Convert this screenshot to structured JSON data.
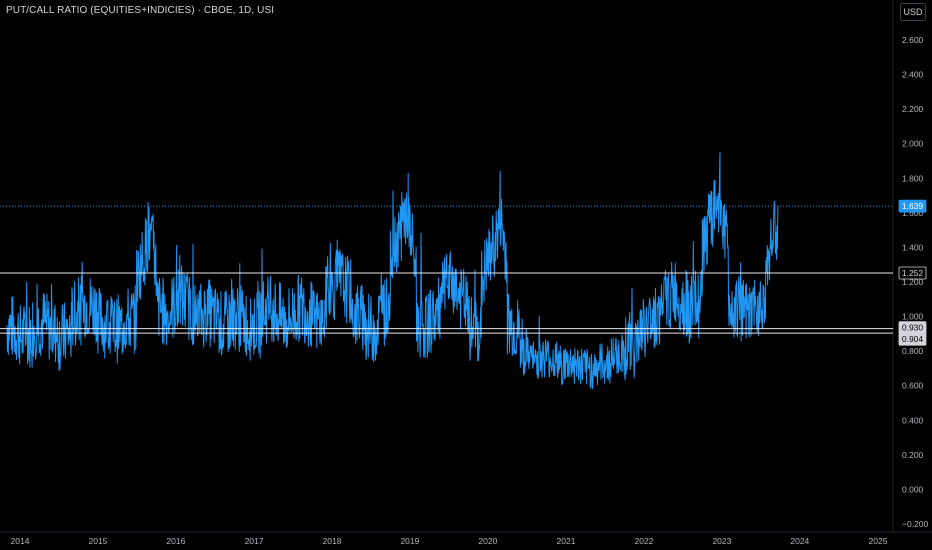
{
  "header": {
    "title": "PUT/CALL RATIO (EQUITIES+INDICIES) · CBOE, 1D, USI",
    "currency_button": "USD"
  },
  "colors": {
    "background": "#000000",
    "series": "#2196f3",
    "level_line": "#ffffff",
    "last_price_tag": "#2196f3",
    "axis_text": "#b2b5be"
  },
  "chart_data": {
    "type": "line",
    "title": "PUT/CALL RATIO (EQUITIES+INDICIES) · CBOE, 1D, USI",
    "xlabel": "",
    "ylabel": "",
    "x_ticks": [
      "2014",
      "2015",
      "2016",
      "2017",
      "2018",
      "2019",
      "2020",
      "2021",
      "2022",
      "2023",
      "2024",
      "2025"
    ],
    "y_ticks": [
      "2.600",
      "2.400",
      "2.200",
      "2.000",
      "1.800",
      "1.600",
      "1.400",
      "1.200",
      "1.000",
      "0.800",
      "0.600",
      "0.400",
      "0.200",
      "0.000",
      "−0.200"
    ],
    "ylim": [
      -0.2,
      2.6
    ],
    "xlim": [
      "2014-01-01",
      "2025-01-01"
    ],
    "grid": false,
    "series": [
      {
        "x": [
          "2013-11-01",
          "2014-01-01",
          "2014-03-01",
          "2014-05-01",
          "2014-07-01",
          "2014-09-01",
          "2014-11-01",
          "2015-01-01",
          "2015-03-01",
          "2015-05-01",
          "2015-07-01",
          "2015-08-24",
          "2015-10-01",
          "2015-12-01",
          "2016-02-01",
          "2016-04-01",
          "2016-06-01",
          "2016-08-01",
          "2016-10-01",
          "2016-12-01",
          "2017-02-01",
          "2017-04-01",
          "2017-06-01",
          "2017-08-01",
          "2017-10-01",
          "2017-12-01",
          "2018-02-01",
          "2018-04-01",
          "2018-06-01",
          "2018-08-01",
          "2018-10-01",
          "2018-12-24",
          "2019-02-01",
          "2019-04-01",
          "2019-06-01",
          "2019-08-01",
          "2019-10-01",
          "2019-12-01",
          "2020-02-28",
          "2020-04-01",
          "2020-06-01",
          "2020-08-01",
          "2020-10-01",
          "2020-12-01",
          "2021-02-01",
          "2021-04-01",
          "2021-06-01",
          "2021-08-01",
          "2021-10-01",
          "2021-12-01",
          "2022-02-01",
          "2022-04-01",
          "2022-06-01",
          "2022-08-01",
          "2022-10-01",
          "2022-12-23",
          "2023-02-01",
          "2023-04-01",
          "2023-06-01",
          "2023-08-01",
          "2023-09-20"
        ],
        "y": [
          1.0,
          0.86,
          0.92,
          1.0,
          0.84,
          0.95,
          1.1,
          1.02,
          0.9,
          0.96,
          1.0,
          1.66,
          1.12,
          0.95,
          1.2,
          0.92,
          1.1,
          0.88,
          1.05,
          0.92,
          0.98,
          1.1,
          0.9,
          1.12,
          0.95,
          1.0,
          1.3,
          1.05,
          0.96,
          0.9,
          1.15,
          1.83,
          0.98,
          0.92,
          1.1,
          1.25,
          0.95,
          0.88,
          1.84,
          1.05,
          0.82,
          0.72,
          0.8,
          0.7,
          0.75,
          0.68,
          0.72,
          0.74,
          0.82,
          0.85,
          1.0,
          1.02,
          1.2,
          0.98,
          1.15,
          1.95,
          1.1,
          1.05,
          0.95,
          1.25,
          1.639
        ]
      }
    ],
    "reference_lines": [
      1.252,
      0.93,
      0.904,
      1.639
    ],
    "price_tags": [
      {
        "value": "1.639",
        "kind": "last"
      },
      {
        "value": "1.252",
        "kind": "level"
      },
      {
        "value": "0.930",
        "kind": "level"
      },
      {
        "value": "0.904",
        "kind": "level"
      }
    ]
  }
}
